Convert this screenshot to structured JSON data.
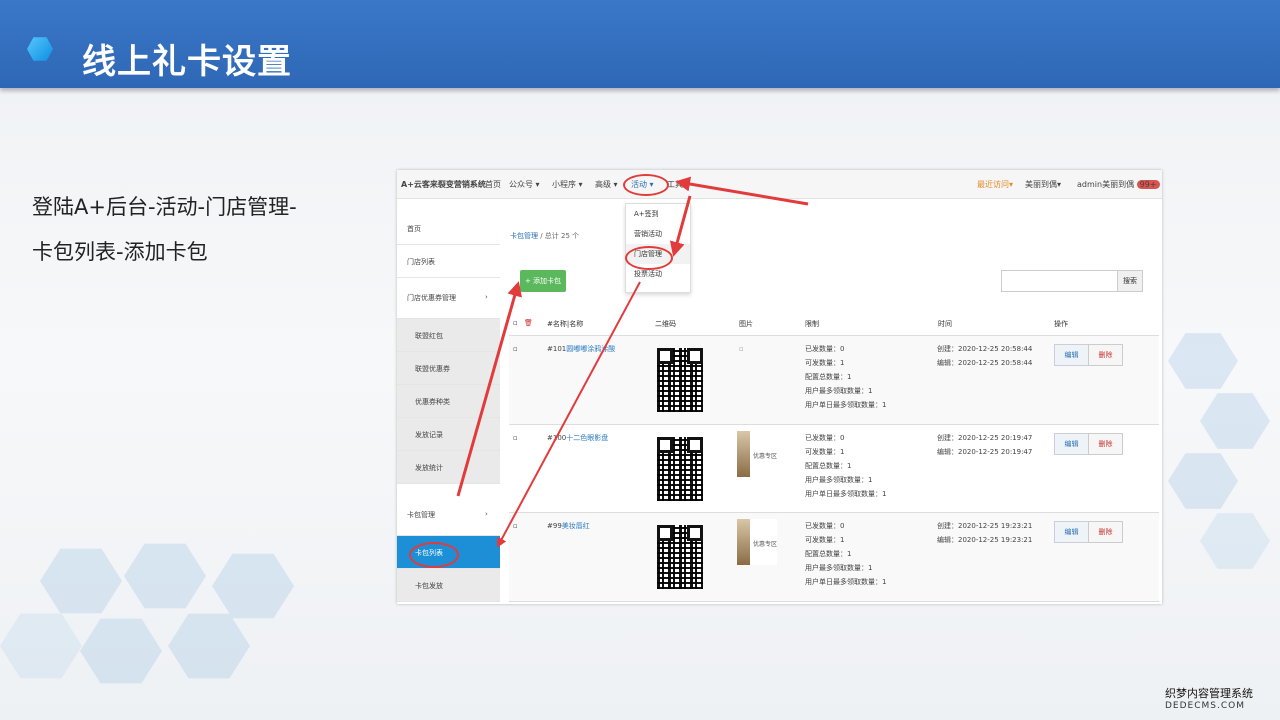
{
  "slide": {
    "title": "线上礼卡设置",
    "instruction_lines": [
      "登陆A+后台-活动-门店管理-",
      "卡包列表-添加卡包"
    ]
  },
  "app": {
    "brand": "A+云客来裂变营销系统",
    "nav": [
      "首页",
      "公众号 ▾",
      "小程序 ▾",
      "高级 ▾",
      "活动 ▾",
      "工具"
    ],
    "right": {
      "recent": "最近访问▾",
      "store": "美丽到偶▾",
      "user": "admin美丽到偶",
      "badge": "99+"
    },
    "dropdown": [
      "A+签到",
      "营销活动",
      "门店管理",
      "投票活动"
    ],
    "sidebar": [
      {
        "label": "首页",
        "icon": "home-icon"
      },
      {
        "label": "门店列表",
        "icon": "home-icon"
      },
      {
        "label": "门店优惠券管理",
        "icon": "image-icon"
      },
      {
        "label": "联盟红包",
        "icon": "list-icon"
      },
      {
        "label": "联盟优惠券",
        "icon": "list-icon"
      },
      {
        "label": "优惠券种类",
        "icon": "list-icon"
      },
      {
        "label": "发放记录",
        "icon": "list-icon"
      },
      {
        "label": "发放统计",
        "icon": "chart-icon"
      },
      {
        "label": "卡包管理",
        "icon": "list-icon"
      },
      {
        "label": "卡包列表",
        "icon": "list-icon"
      },
      {
        "label": "卡包发放",
        "icon": "list-icon"
      }
    ],
    "breadcrumb": {
      "link": "卡包管理",
      "rest": " / 总计 25 个"
    },
    "add_button": "+ 添加卡包",
    "search_button": "搜索",
    "columns": [
      "#名称|名称",
      "二维码",
      "图片",
      "限制",
      "时间",
      "操作"
    ],
    "rows": [
      {
        "id": "#101",
        "name": "圆嘟嘟涂鸦涂酸",
        "limits": [
          "已发数量：0",
          "可发数量：1",
          "配置总数量：1",
          "用户最多领取数量：1",
          "用户单日最多领取数量：1"
        ],
        "created": "创建：2020-12-25 20:58:44",
        "edited": "编辑：2020-12-25 20:58:44",
        "image_text": ""
      },
      {
        "id": "#100",
        "name": "十二色眼影盘",
        "limits": [
          "已发数量：0",
          "可发数量：1",
          "配置总数量：1",
          "用户最多领取数量：1",
          "用户单日最多领取数量：1"
        ],
        "created": "创建：2020-12-25 20:19:47",
        "edited": "编辑：2020-12-25 20:19:47",
        "image_text": "优惠专区"
      },
      {
        "id": "#99",
        "name": "美妆唇红",
        "limits": [
          "已发数量：0",
          "可发数量：1",
          "配置总数量：1",
          "用户最多领取数量：1",
          "用户单日最多领取数量：1"
        ],
        "created": "创建：2020-12-25 19:23:21",
        "edited": "编辑：2020-12-25 19:23:21",
        "image_text": "优惠专区"
      }
    ],
    "edit_label": "编辑",
    "delete_label": "删除"
  },
  "watermark": {
    "line1": "织梦内容管理系统",
    "line2": "DEDECMS.COM"
  },
  "colors": {
    "header": "#2e67b6",
    "accent_blue": "#1c8fd6",
    "add_green": "#5cb85c",
    "annotation_red": "#e23b3b"
  }
}
